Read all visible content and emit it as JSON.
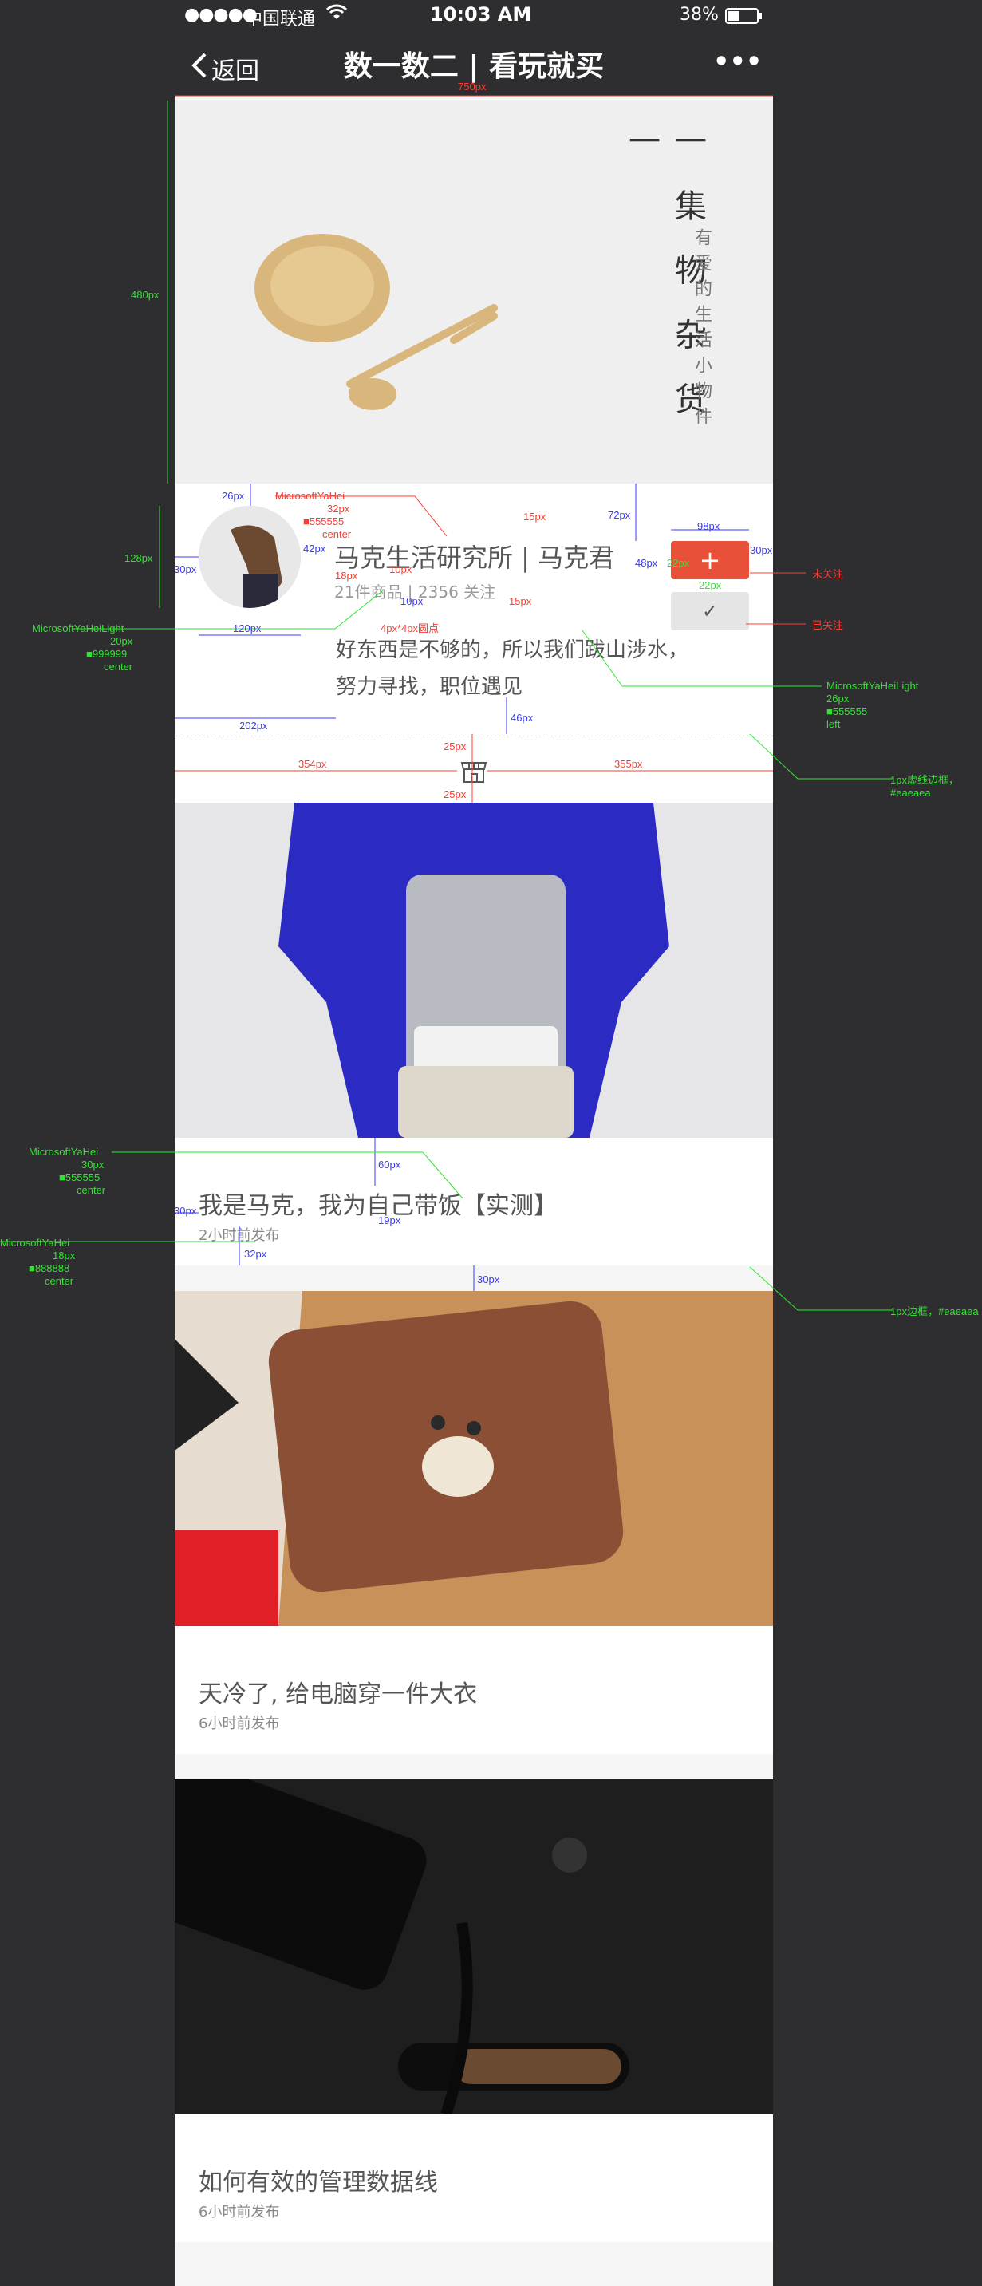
{
  "status_bar": {
    "signal": "●●●●●",
    "carrier": "中国联通",
    "time": "10:03 AM",
    "battery": "38%"
  },
  "nav": {
    "back_label": "返回",
    "title": "数一数二 | 看玩就买",
    "more_label": "•••"
  },
  "banner": {
    "title": "一 集 物 杂 货 一",
    "subtitle": "有爱的生活小物件"
  },
  "profile": {
    "name": "马克生活研究所 | 马克君",
    "stats": "21件商品 | 2356 关注",
    "bio_line1": "好东西是不够的，所以我们跋山涉水，",
    "bio_line2": "努力寻找，职位遇见",
    "follow_label": "+",
    "followed_label": "✓"
  },
  "articles": [
    {
      "title": "我是马克，我为自己带饭【实测】",
      "time": "2小时前发布"
    },
    {
      "title": "天冷了, 给电脑穿一件大衣",
      "time": "6小时前发布"
    },
    {
      "title": "如何有效的管理数据线",
      "time": "6小时前发布"
    }
  ],
  "annotations": {
    "a_750": "750px",
    "a_480": "480px",
    "a_128": "128px",
    "a_26": "26px",
    "a_30a": "30px",
    "a_42": "42px",
    "a_120": "120px",
    "a_202": "202px",
    "a_yahei": "MicrosoftYaHei",
    "a_32": "32px",
    "a_555": "■555555",
    "a_center": "center",
    "a_18": "18px",
    "a_10a": "10px",
    "a_10b": "10px",
    "a_dot": "4px*4px圆点",
    "a_15a": "15px",
    "a_15b": "15px",
    "a_72": "72px",
    "a_48": "48px",
    "a_98": "98px",
    "a_30b": "30px",
    "a_22a": "22px",
    "a_22b": "22px",
    "a_unfollow": "未关注",
    "a_followed": "已关注",
    "a_light": "MicrosoftYaHeiLight",
    "a_20": "20px",
    "a_999": "■999999",
    "a_center2": "center",
    "a_light2": "MicrosoftYaHeiLight",
    "a_26b": "26px",
    "a_5552": "■555555",
    "a_left": "left",
    "a_46": "46px",
    "a_25a": "25px",
    "a_25b": "25px",
    "a_354": "354px",
    "a_355": "355px",
    "a_border1": "1px虚线边框，",
    "a_eaeaea1": "#eaeaea",
    "a_yahei2": "MicrosoftYaHei",
    "a_30c": "30px",
    "a_5553": "■555555",
    "a_center3": "center",
    "a_60": "60px",
    "a_30d": "30px",
    "a_19": "19px",
    "a_yahei3": "MicrosoftYaHei",
    "a_18b": "18px",
    "a_888": "■888888",
    "a_center4": "center",
    "a_32b": "32px",
    "a_30e": "30px",
    "a_border2": "1px边框，#eaeaea"
  },
  "colors": {
    "accent": "#e8503a",
    "text_main": "#555555",
    "text_light": "#999999",
    "text_time": "#888888",
    "border": "#eaeaea",
    "chrome": "#2e2e30"
  }
}
